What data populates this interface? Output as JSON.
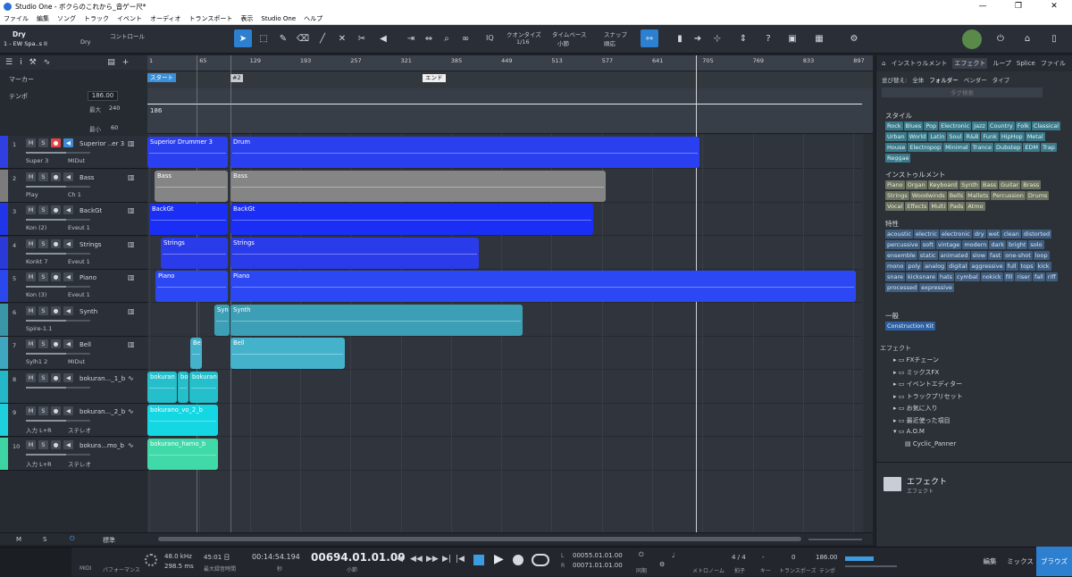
{
  "window": {
    "title": "Studio One - ボクらのこれから_音ゲー尺*",
    "controls": [
      "—",
      "❐",
      "✕"
    ]
  },
  "menu": [
    "ファイル",
    "編集",
    "ソング",
    "トラック",
    "イベント",
    "オーディオ",
    "トランスポート",
    "表示",
    "Studio One",
    "ヘルプ"
  ],
  "toolbar": {
    "track_label_top": "Dry",
    "track_label_bottom": "1 - EW Spa..s II",
    "preset": "Dry",
    "control_label": "コントロール",
    "quantize_label": "クオンタイズ",
    "quantize_value": "1/16",
    "timebase_label": "タイムベース",
    "timebase_value": "小節",
    "snap_label": "スナップ",
    "snap_value": "順応",
    "iq_label": "IQ"
  },
  "left_header": {
    "marker_label": "マーカー",
    "tempo_label": "テンポ",
    "tempo_value": "186.00",
    "max_label": "最大",
    "max_value": "240",
    "min_label": "最小",
    "min_value": "60"
  },
  "ruler": {
    "ticks": [
      "1",
      "65",
      "129",
      "193",
      "257",
      "321",
      "385",
      "449",
      "513",
      "577",
      "641",
      "705",
      "769",
      "833",
      "897"
    ]
  },
  "markers": {
    "start": "スタート",
    "marker2": "#2",
    "end": "エンド"
  },
  "tempo_lane_value": "186",
  "tracks": [
    {
      "num": "1",
      "name": "Superior ..er 3",
      "io1": "Super 3",
      "io2": "MIDut",
      "color": "#2f3fe0",
      "kind": "inst"
    },
    {
      "num": "2",
      "name": "Bass",
      "io1": "Play",
      "io2": "Ch 1",
      "color": "#7c7c7c",
      "kind": "inst"
    },
    {
      "num": "3",
      "name": "BackGt",
      "io1": "Kon (2)",
      "io2": "Eveut 1",
      "color": "#2035e8",
      "kind": "inst"
    },
    {
      "num": "4",
      "name": "Strings",
      "io1": "Konkt 7",
      "io2": "Eveut 1",
      "color": "#2a3ad8",
      "kind": "inst"
    },
    {
      "num": "5",
      "name": "Piano",
      "io1": "Kon (3)",
      "io2": "Eveut 1",
      "color": "#2a48ee",
      "kind": "inst"
    },
    {
      "num": "6",
      "name": "Synth",
      "io1": "Spire-1.1",
      "io2": "",
      "color": "#3a95a8",
      "kind": "inst"
    },
    {
      "num": "7",
      "name": "Bell",
      "io1": "Sylh1 2",
      "io2": "MIDut",
      "color": "#3fa6bf",
      "kind": "inst"
    },
    {
      "num": "8",
      "name": "bokuran..._1_b",
      "io1": "",
      "io2": "",
      "color": "#24b7c7",
      "kind": "audio"
    },
    {
      "num": "9",
      "name": "bokuran..._2_b",
      "io1": "入力 L+R",
      "io2": "ステレオ",
      "color": "#1ed0dc",
      "kind": "audio"
    },
    {
      "num": "10",
      "name": "bokura...mo_b",
      "io1": "入力 L+R",
      "io2": "ステレオ",
      "color": "#3dd3a3",
      "kind": "audio"
    }
  ],
  "clips": [
    {
      "lane": 0,
      "start": 0,
      "end": 90,
      "label": "Superior Drummer 3",
      "color": "#2a3ff0"
    },
    {
      "lane": 0,
      "start": 93,
      "end": 618,
      "label": "Drum",
      "color": "#2a3ff0"
    },
    {
      "lane": 1,
      "start": 8,
      "end": 90,
      "label": "Bass",
      "color": "#858585"
    },
    {
      "lane": 1,
      "start": 93,
      "end": 513,
      "label": "Bass",
      "color": "#858585"
    },
    {
      "lane": 2,
      "start": 2,
      "end": 90,
      "label": "BackGt",
      "color": "#1a2ef5"
    },
    {
      "lane": 2,
      "start": 93,
      "end": 499,
      "label": "BackGt",
      "color": "#1a2ef5"
    },
    {
      "lane": 3,
      "start": 15,
      "end": 90,
      "label": "Strings",
      "color": "#2a3bea"
    },
    {
      "lane": 3,
      "start": 93,
      "end": 371,
      "label": "Strings",
      "color": "#2a3bea"
    },
    {
      "lane": 4,
      "start": 9,
      "end": 90,
      "label": "Piano",
      "color": "#2c48f5"
    },
    {
      "lane": 4,
      "start": 93,
      "end": 793,
      "label": "Piano",
      "color": "#2c48f5"
    },
    {
      "lane": 5,
      "start": 75,
      "end": 92,
      "label": "Syn",
      "color": "#3d9fb5"
    },
    {
      "lane": 5,
      "start": 93,
      "end": 420,
      "label": "Synth",
      "color": "#3d9fb5"
    },
    {
      "lane": 6,
      "start": 48,
      "end": 61,
      "label": "Be",
      "color": "#45b2cc"
    },
    {
      "lane": 6,
      "start": 93,
      "end": 221,
      "label": "Bell",
      "color": "#45b2cc"
    },
    {
      "lane": 7,
      "start": 0,
      "end": 33,
      "label": "bokuran",
      "color": "#25bfcc"
    },
    {
      "lane": 7,
      "start": 34,
      "end": 46,
      "label": "bo",
      "color": "#25bfcc"
    },
    {
      "lane": 7,
      "start": 47,
      "end": 79,
      "label": "bokuran",
      "color": "#25bfcc"
    },
    {
      "lane": 8,
      "start": 0,
      "end": 79,
      "label": "bokurano_vo_2_b",
      "color": "#14d7e3"
    },
    {
      "lane": 9,
      "start": 0,
      "end": 79,
      "label": "bokurano_hamo_b",
      "color": "#3fdaa8"
    }
  ],
  "right_panel": {
    "tabs": [
      "インストゥルメント",
      "エフェクト",
      "ループ",
      "Splice",
      "ファイル"
    ],
    "filter_label": "並び替え:",
    "filter_tabs": [
      "全体",
      "フォルダー",
      "ベンダー",
      "タイプ"
    ],
    "search_placeholder": "タグ検索",
    "style_title": "スタイル",
    "style_tags": [
      "Rock",
      "Blues",
      "Pop",
      "Electronic",
      "Jazz",
      "Country",
      "Folk",
      "Classical",
      "Urban",
      "World",
      "Latin",
      "Soul",
      "R&B",
      "Funk",
      "HipHop",
      "Metal",
      "House",
      "Electropop",
      "Minimal",
      "Trance",
      "Dubstep",
      "EDM",
      "Trap",
      "Reggae"
    ],
    "instrument_title": "インストゥルメント",
    "instrument_tags": [
      "Piano",
      "Organ",
      "Keyboard",
      "Synth",
      "Bass",
      "Guitar",
      "Brass",
      "Strings",
      "Woodwinds",
      "Bells",
      "Mallets",
      "Percussion",
      "Drums",
      "Vocal",
      "Effects",
      "Multi",
      "Pads",
      "Atmo"
    ],
    "character_title": "特性",
    "character_tags": [
      "acoustic",
      "electric",
      "electronic",
      "dry",
      "wet",
      "clean",
      "distorted",
      "percussive",
      "soft",
      "vintage",
      "modern",
      "dark",
      "bright",
      "solo",
      "ensemble",
      "static",
      "animated",
      "slow",
      "fast",
      "one-shot",
      "loop",
      "mono",
      "poly",
      "analog",
      "digital",
      "aggressive",
      "full",
      "tops",
      "kick",
      "snare",
      "kicksnare",
      "hats",
      "cymbal",
      "nokick",
      "fill",
      "riser",
      "fall",
      "riff",
      "processed",
      "expressive"
    ],
    "general_title": "一般",
    "general_tags": [
      "Construction Kit"
    ],
    "effects_header": "エフェクト",
    "tree": [
      "FXチェーン",
      "ミックスFX",
      "イベントエディター",
      "トラックプリセット",
      "お気に入り",
      "最近使った項目",
      "A.O.M",
      "Cyclic_Panner"
    ],
    "bottom_title": "エフェクト",
    "bottom_subtitle": "エフェクト"
  },
  "bottom_bar": {
    "m": "M",
    "s": "S",
    "zoom_label": "標準"
  },
  "transport": {
    "midi": "MIDI",
    "performance": "パフォーマンス",
    "sample_rate": "48.0 kHz",
    "latency": "298.5 ms",
    "rec_time": "45:01 日",
    "rec_label": "最大録音時間",
    "clock_sec": "00:14:54.194",
    "clock_sec_label": "秒",
    "clock_bars": "00694.01.01.00",
    "clock_bars_label": "小節",
    "loop_l": "00055.01.01.00",
    "loop_r": "00071.01.01.00",
    "loop_l_label": "L",
    "loop_r_label": "R",
    "sync_label": "同期",
    "metronome_label": "メトロノーム",
    "time_sig": "4 / 4",
    "time_sig_label": "拍子",
    "key_label": "キー",
    "transpose": "0",
    "transpose_label": "トランスポーズ",
    "tempo": "186.00",
    "tempo_label": "テンポ",
    "tab_edit": "編集",
    "tab_mix": "ミックス",
    "tab_browse": "ブラウズ"
  },
  "colors": {
    "accent": "#2d7fd0",
    "record": "#e24545"
  }
}
